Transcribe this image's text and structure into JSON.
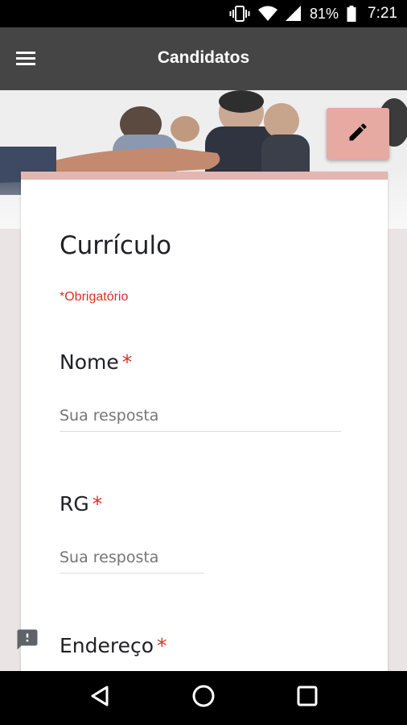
{
  "status_bar": {
    "battery": "81%",
    "time": "7:21",
    "icons": [
      "vibrate-icon",
      "wifi-icon",
      "signal-icon",
      "battery-icon"
    ]
  },
  "app_bar": {
    "title": "Candidatos",
    "menu_icon": "hamburger-menu-icon"
  },
  "header": {
    "edit_icon": "pencil-icon",
    "accent_color": "#e6aaa3"
  },
  "form": {
    "title": "Currículo",
    "required_note": "*Obrigatório",
    "questions": [
      {
        "label": "Nome",
        "required_mark": "*",
        "placeholder": "Sua resposta"
      },
      {
        "label": "RG",
        "required_mark": "*",
        "placeholder": "Sua resposta"
      },
      {
        "label": "Endereço",
        "required_mark": "*"
      }
    ]
  },
  "feedback_icon": "feedback-icon",
  "nav_bar": {
    "icons": [
      "back-icon",
      "home-icon",
      "recents-icon"
    ]
  }
}
